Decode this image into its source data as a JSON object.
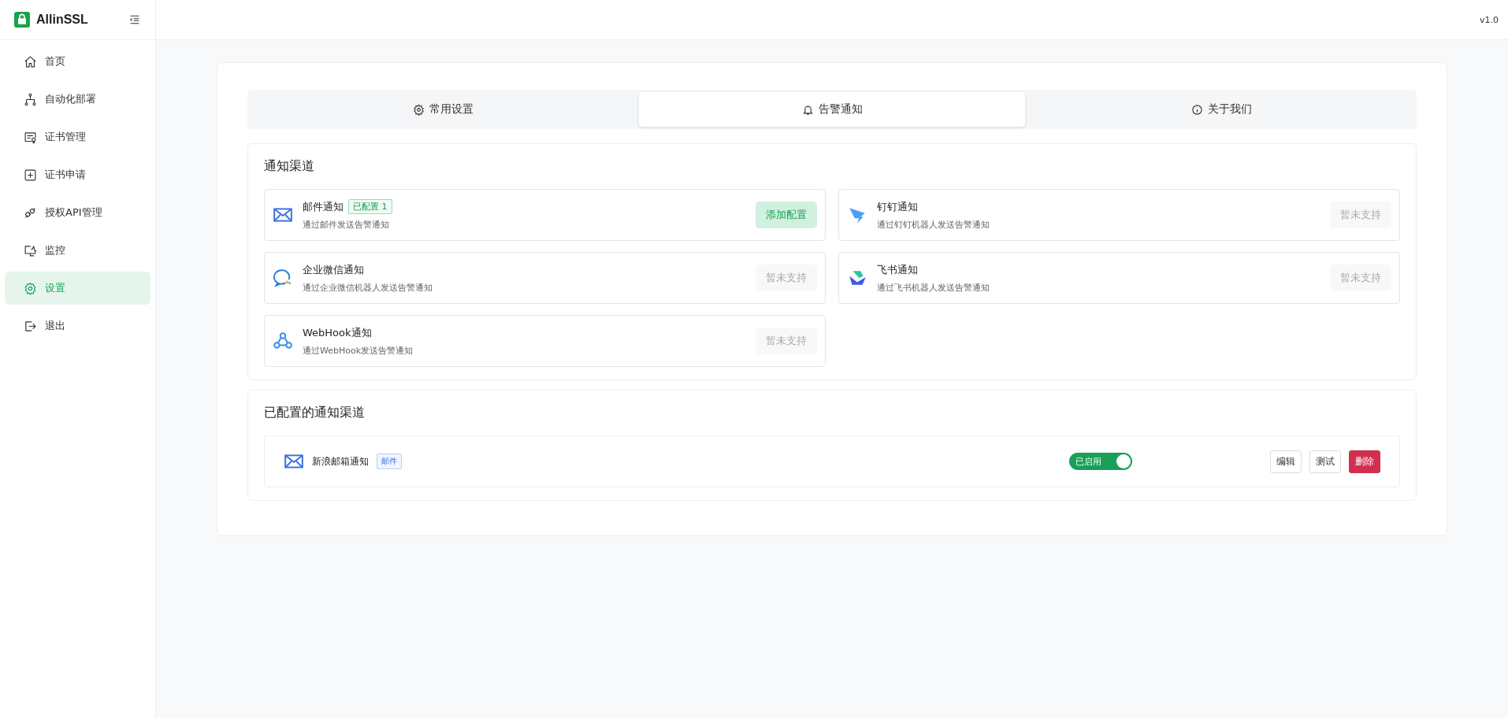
{
  "sidebar": {
    "brand": "AllinSSL",
    "items": [
      {
        "kind": "home",
        "label": "首页",
        "selected": false
      },
      {
        "kind": "deploy",
        "label": "自动化部署",
        "selected": false
      },
      {
        "kind": "cert",
        "label": "证书管理",
        "selected": false
      },
      {
        "kind": "apply",
        "label": "证书申请",
        "selected": false
      },
      {
        "kind": "api",
        "label": "授权API管理",
        "selected": false
      },
      {
        "kind": "monitor",
        "label": "监控",
        "selected": false
      },
      {
        "kind": "settings",
        "label": "设置",
        "selected": true
      },
      {
        "kind": "logout",
        "label": "退出",
        "selected": false
      }
    ]
  },
  "header": {
    "version": "v1.0"
  },
  "tabs": [
    {
      "kind": "gear",
      "label": "常用设置",
      "selected": false
    },
    {
      "kind": "bell",
      "label": "告警通知",
      "selected": true
    },
    {
      "kind": "info",
      "label": "关于我们",
      "selected": false
    }
  ],
  "channels_section": {
    "title": "通知渠道",
    "channels": [
      {
        "kind": "mail",
        "name": "邮件通知",
        "badge": "已配置 1",
        "description": "通过邮件发送告警通知",
        "button": "添加配置",
        "disabled": false
      },
      {
        "kind": "dingtalk",
        "name": "钉钉通知",
        "description": "通过钉钉机器人发送告警通知",
        "button": "暂未支持",
        "disabled": true
      },
      {
        "kind": "wecom",
        "name": "企业微信通知",
        "description": "通过企业微信机器人发送告警通知",
        "button": "暂未支持",
        "disabled": true
      },
      {
        "kind": "feishu",
        "name": "飞书通知",
        "description": "通过飞书机器人发送告警通知",
        "button": "暂未支持",
        "disabled": true
      },
      {
        "kind": "webhook",
        "name": "WebHook通知",
        "description": "通过WebHook发送告警通知",
        "button": "暂未支持",
        "disabled": true
      }
    ]
  },
  "configured_section": {
    "title": "已配置的通知渠道",
    "rows": [
      {
        "kind": "mail",
        "name": "新浪邮箱通知",
        "tag": "邮件",
        "toggle_label": "已启用",
        "on": true,
        "actions": [
          {
            "kind": "plain",
            "label": "编辑"
          },
          {
            "kind": "plain",
            "label": "测试"
          },
          {
            "kind": "danger",
            "label": "删除"
          }
        ]
      }
    ]
  }
}
